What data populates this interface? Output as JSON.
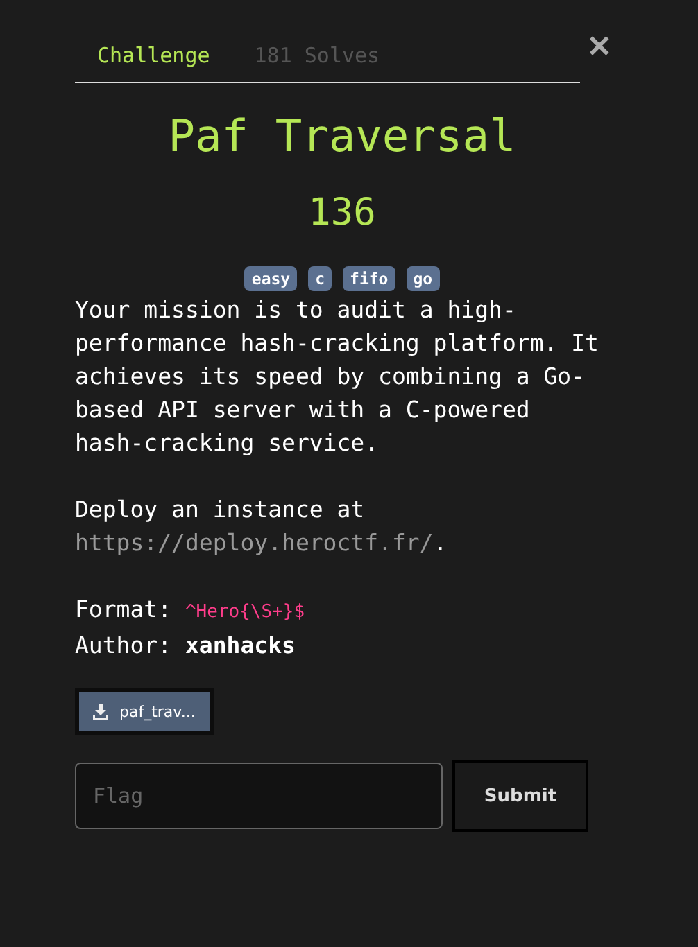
{
  "tabs": [
    {
      "label": "Challenge",
      "selected": true
    },
    {
      "label": "181 Solves",
      "selected": false
    }
  ],
  "title": "Paf Traversal",
  "points": "136",
  "tags": [
    "easy",
    "c",
    "fifo",
    "go"
  ],
  "description": "Your mission is to audit a high-performance hash-cracking platform. It achieves its speed by combining a Go-based API server with a C-powered hash-cracking service.",
  "deploy": {
    "text": "Deploy an instance at",
    "link": "https://deploy.heroctf.fr/",
    "suffix": "."
  },
  "format": {
    "label": "Format:",
    "value": "^Hero{\\S+}$"
  },
  "author": {
    "label": "Author:",
    "value": "xanhacks"
  },
  "files": [
    "paf_trav..."
  ],
  "flag_field": {
    "placeholder": "Flag"
  },
  "submit": "Submit"
}
